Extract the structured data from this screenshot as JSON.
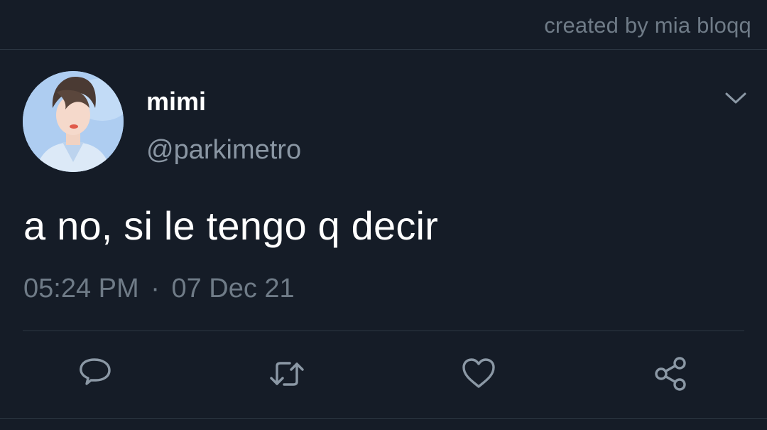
{
  "watermark": "created by mia bloqq",
  "author": {
    "display_name": "mimi",
    "handle": "@parkimetro"
  },
  "tweet": {
    "text": "a no, si le tengo q decir",
    "time": "05:24 PM",
    "separator": "·",
    "date": "07 Dec 21"
  },
  "actions": {
    "icons": [
      "reply-icon",
      "retweet-icon",
      "like-icon",
      "share-icon"
    ]
  },
  "colors": {
    "background": "#151c27",
    "secondary_text": "#6f7b87",
    "divider": "#2c3642",
    "icon": "#8b98a5"
  }
}
